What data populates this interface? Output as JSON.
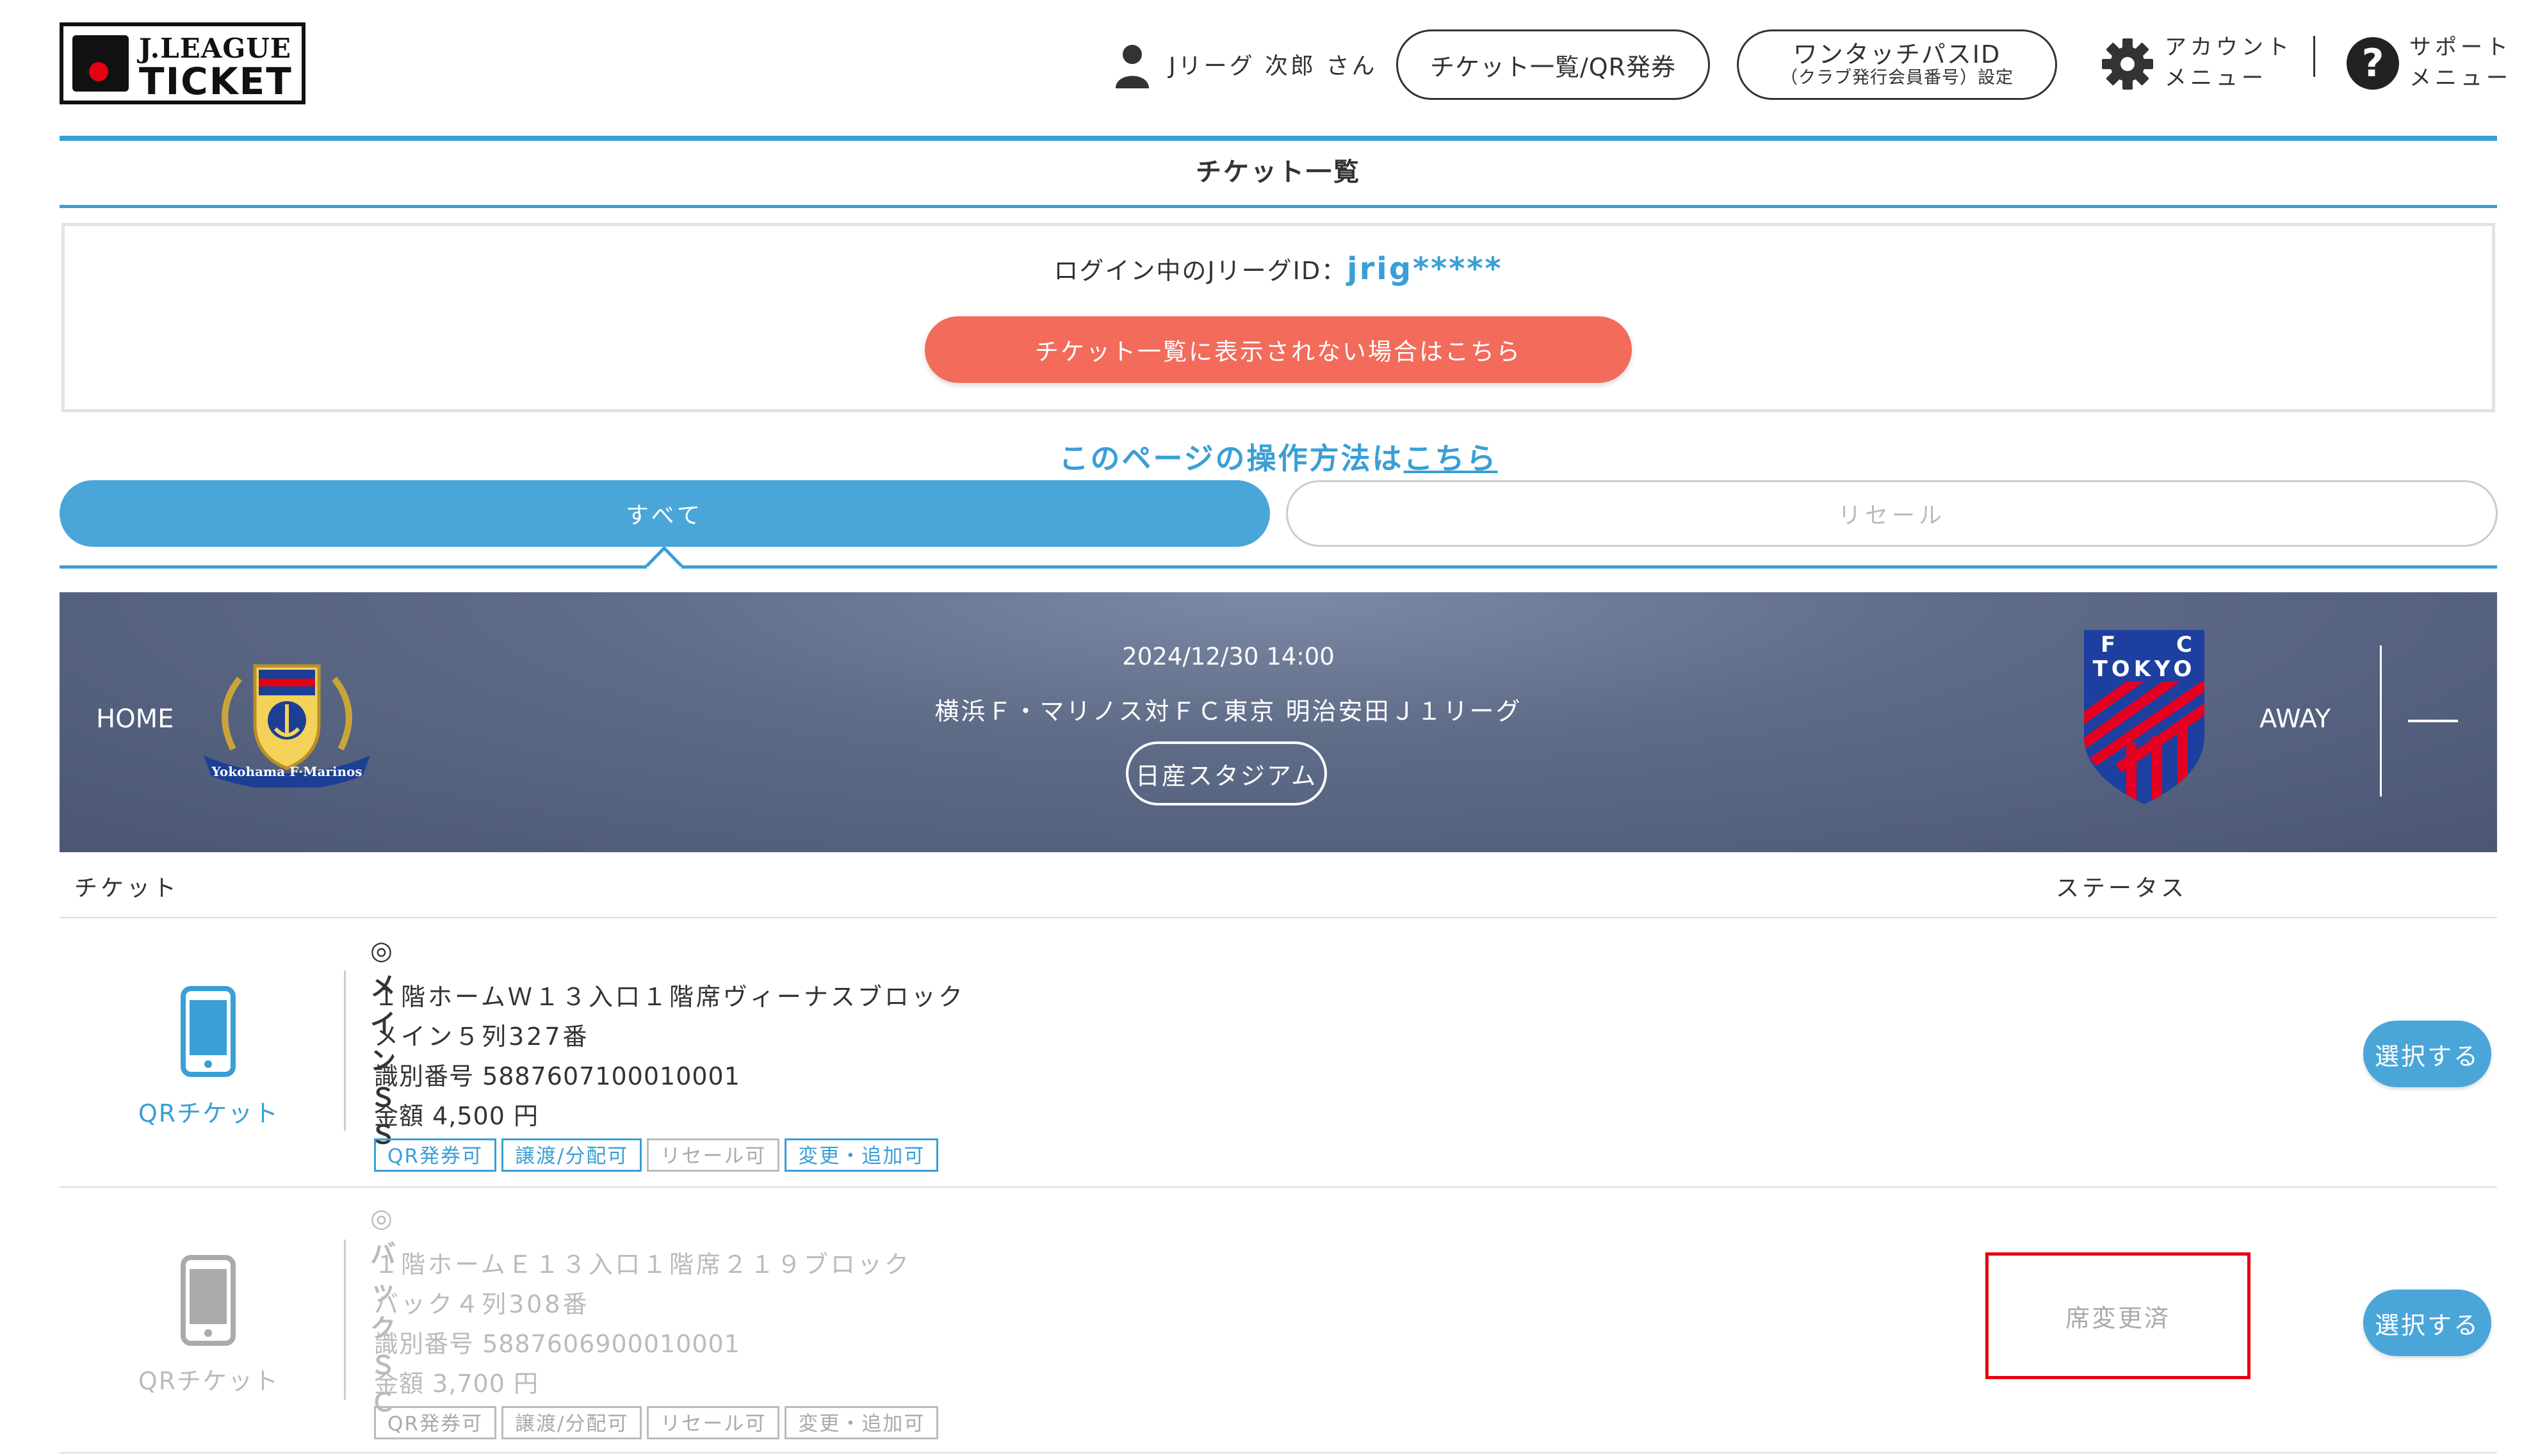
{
  "header": {
    "logo_top": "J.LEAGUE",
    "logo_bottom": "TICKET",
    "user_name": "Jリーグ 次郎 さん",
    "ticket_list_btn": "チケット一覧/QR発券",
    "touchpass_line1": "ワンタッチパスID",
    "touchpass_line2": "（クラブ発行会員番号）設定",
    "account_line1": "アカウント",
    "account_line2": "メニュー",
    "support_line1": "サポート",
    "support_line2": "メニュー",
    "help_glyph": "?"
  },
  "page": {
    "title": "チケット一覧"
  },
  "login": {
    "prefix": "ログイン中のJリーグID：",
    "id": "jrig*****",
    "missing_btn": "チケット一覧に表示されない場合はこちら"
  },
  "howto": {
    "text": "このページの操作方法は",
    "link": "こちら"
  },
  "tabs": {
    "all": "すべて",
    "resale": "リセール"
  },
  "match": {
    "home_label": "HOME",
    "away_label": "AWAY",
    "datetime": "2024/12/30 14:00",
    "title": "横浜Ｆ・マリノス対ＦＣ東京 明治安田Ｊ１リーグ",
    "venue": "日産スタジアム",
    "home_crest_text": "Yokohama F·Marinos",
    "away_crest_f": "F",
    "away_crest_c": "C",
    "away_crest_tokyo": "TOKYO"
  },
  "columns": {
    "ticket": "チケット",
    "status": "ステータス"
  },
  "tickets": [
    {
      "type": "QRチケット",
      "name": "◎メインＳＳ",
      "seat": "１階ホームＷ１３入口１階席ヴィーナスブロック",
      "row": "メイン５列327番",
      "ident": "識別番号 5887607100010001",
      "price": "金額 4,500 円",
      "tags": [
        "QR発券可",
        "譲渡/分配可",
        "リセール可",
        "変更・追加可"
      ],
      "status": "",
      "select": "選択する"
    },
    {
      "type": "QRチケット",
      "name": "◎バックＳＣ",
      "seat": "１階ホームＥ１３入口１階席２１９ブロック",
      "row": "バック４列308番",
      "ident": "識別番号 5887606900010001",
      "price": "金額 3,700 円",
      "tags": [
        "QR発券可",
        "譲渡/分配可",
        "リセール可",
        "変更・追加可"
      ],
      "status": "席変更済",
      "select": "選択する"
    }
  ],
  "colors": {
    "accent": "#3a9fd6",
    "alert": "#f26b5b",
    "highlight": "#e60012"
  }
}
